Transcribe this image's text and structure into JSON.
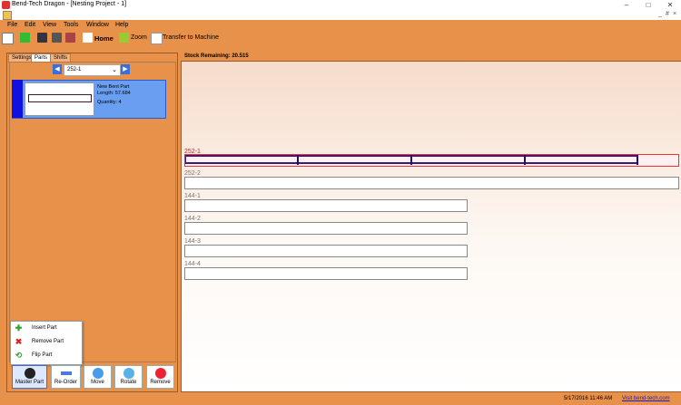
{
  "window": {
    "title": "Bend-Tech Dragon - [Nesting Project - 1]",
    "minimize": "–",
    "maximize": "□",
    "close": "✕"
  },
  "mdi": {
    "minimize": "_",
    "restore": "#",
    "close": "×"
  },
  "menu": [
    "File",
    "Edit",
    "View",
    "Tools",
    "Window",
    "Help"
  ],
  "toolbar": {
    "home": "Home",
    "zoom": "Zoom",
    "transfer": "Transfer to Machine"
  },
  "left_panel": {
    "tabs": [
      "Settings",
      "Parts",
      "Shifts"
    ],
    "active_tab": "Parts",
    "selector_value": "252-1",
    "part": {
      "name": "New Bent Part",
      "length": "Length: 57.684",
      "quantity": "Quantity: 4"
    },
    "context_menu": [
      "Insert Part",
      "Remove Part",
      "Flip Part"
    ],
    "buttons": [
      "Master Part",
      "Re-Order",
      "Move",
      "Rotate",
      "Remove"
    ]
  },
  "right_panel": {
    "stock_remaining": "Stock Remaining: 20.515",
    "stocks": [
      {
        "label": "252-1",
        "active": true
      },
      {
        "label": "252-2",
        "active": false
      },
      {
        "label": "144-1",
        "active": false
      },
      {
        "label": "144-2",
        "active": false
      },
      {
        "label": "144-3",
        "active": false
      },
      {
        "label": "144-4",
        "active": false
      }
    ]
  },
  "status": {
    "date": "5/17/2016   11:46 AM",
    "link": "Visit bend-tech.com"
  },
  "colors": {
    "accent": "#e8914a",
    "selected_card": "#6a9ef0",
    "active_stock": "#ee3333"
  }
}
